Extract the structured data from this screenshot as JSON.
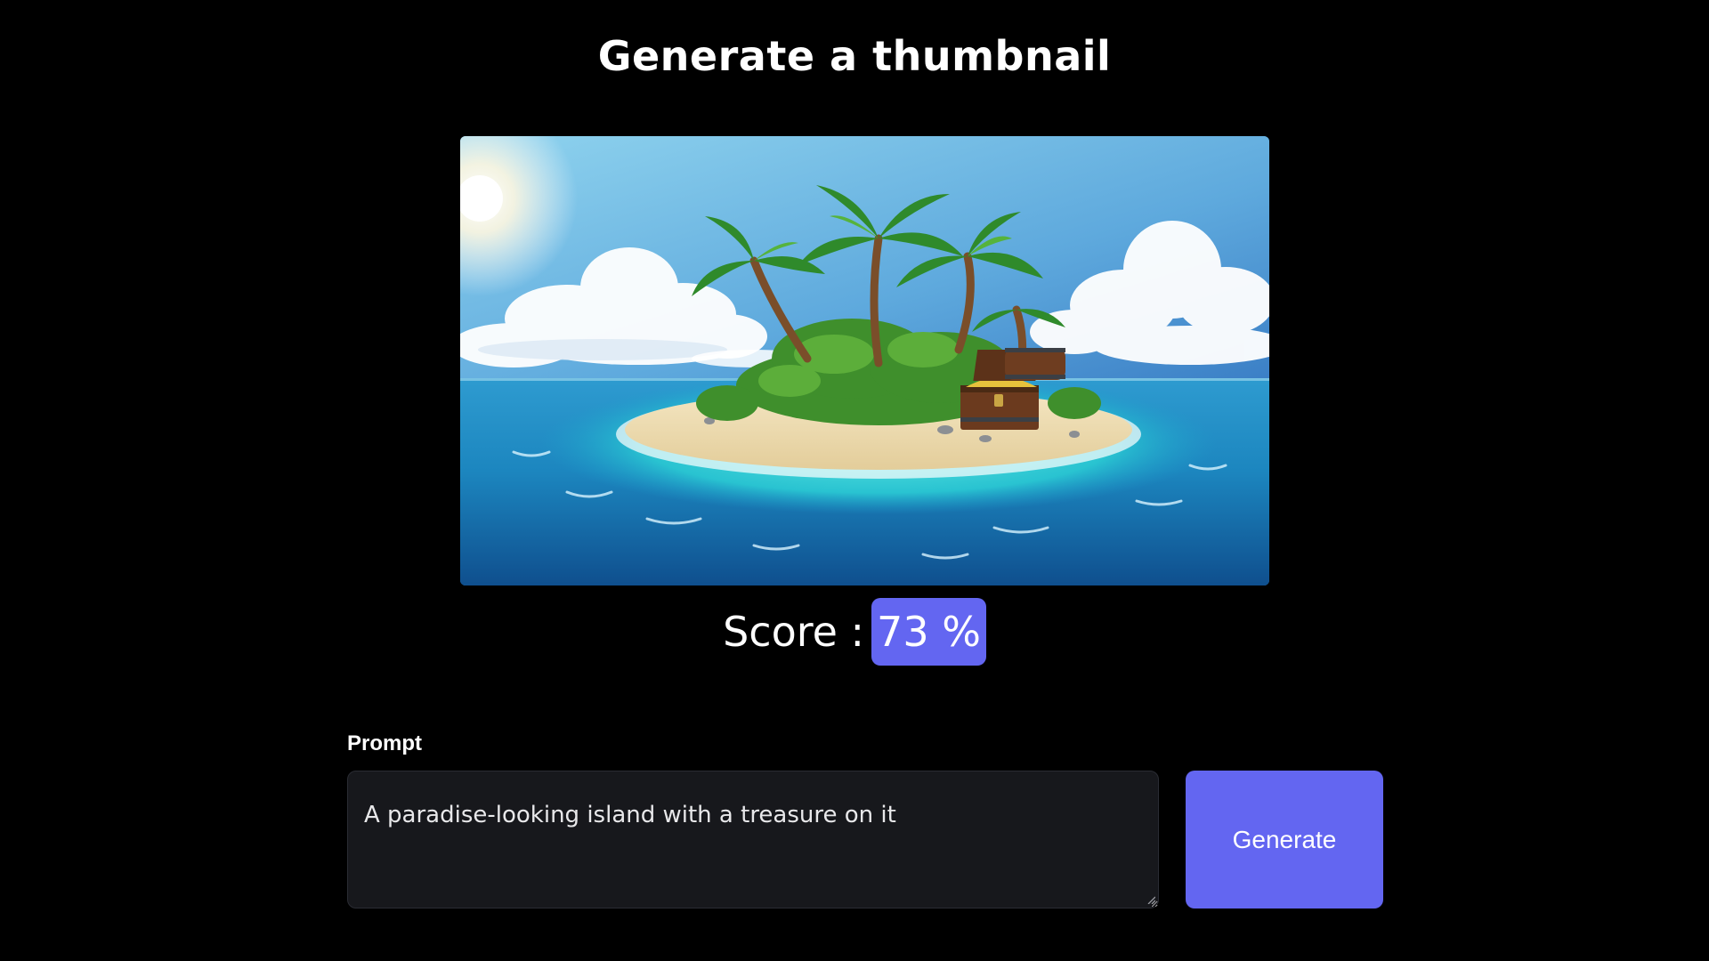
{
  "header": {
    "title": "Generate a thumbnail"
  },
  "thumbnail": {
    "subject": "tropical island with palm trees and an open treasure chest in the ocean"
  },
  "score": {
    "label": "Score :",
    "value": "73 %",
    "percent": 73
  },
  "prompt": {
    "label": "Prompt",
    "value": "A paradise-looking island with a treasure on it"
  },
  "actions": {
    "generate_label": "Generate"
  },
  "colors": {
    "background": "#000000",
    "accent": "#6366f1",
    "input_background": "#17181c"
  }
}
